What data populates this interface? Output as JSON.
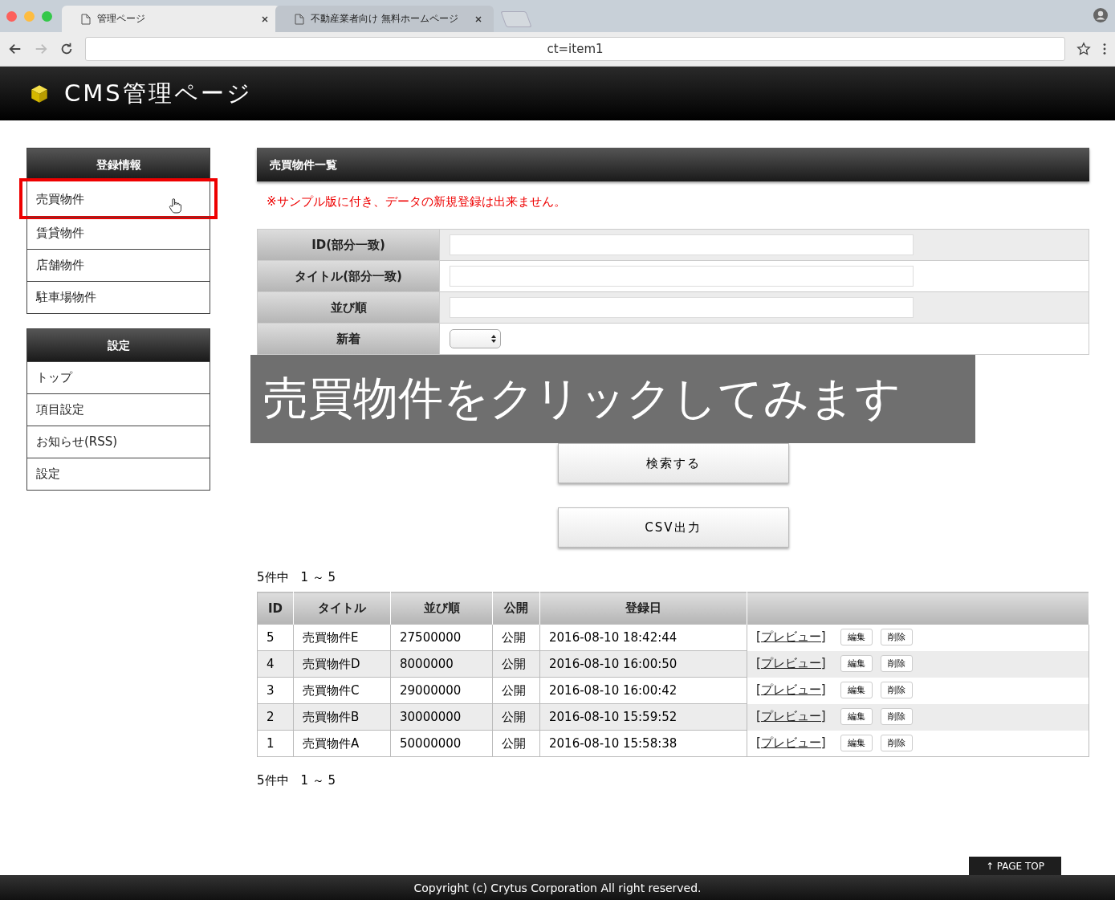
{
  "browser": {
    "tabs": [
      {
        "title": "管理ページ",
        "selected": true
      },
      {
        "title": "不動産業者向け 無料ホームページ",
        "selected": false
      }
    ],
    "address": "ct=item1"
  },
  "header": {
    "title": "CMS管理ページ"
  },
  "sidebar": [
    {
      "heading": "登録情報",
      "items": [
        {
          "label": "売買物件",
          "selected": true
        },
        {
          "label": "賃貸物件",
          "selected": false
        },
        {
          "label": "店舗物件",
          "selected": false
        },
        {
          "label": "駐車場物件",
          "selected": false
        }
      ]
    },
    {
      "heading": "設定",
      "items": [
        {
          "label": "トップ",
          "selected": false
        },
        {
          "label": "項目設定",
          "selected": false
        },
        {
          "label": "お知らせ(RSS)",
          "selected": false
        },
        {
          "label": "設定",
          "selected": false
        }
      ]
    }
  ],
  "main": {
    "title": "売買物件一覧",
    "notice": "※サンプル版に付き、データの新規登録は出来ません。",
    "form": [
      {
        "label": "ID(部分一致)",
        "kind": "text"
      },
      {
        "label": "タイトル(部分一致)",
        "kind": "text"
      },
      {
        "label": "並び順",
        "kind": "text"
      },
      {
        "label": "新着",
        "kind": "select"
      }
    ],
    "search_button": "検索する",
    "csv_button": "CSV出力",
    "count_top": "5件中　1 ～ 5",
    "table": {
      "columns": [
        "ID",
        "タイトル",
        "並び順",
        "公開",
        "登録日"
      ],
      "rows": [
        {
          "cells": [
            "5",
            "売買物件E",
            "27500000",
            "公開",
            "2016-08-10 18:42:44"
          ],
          "preview": "[プレビュー]",
          "edit": "編集",
          "delete": "削除"
        },
        {
          "cells": [
            "4",
            "売買物件D",
            "8000000",
            "公開",
            "2016-08-10 16:00:50"
          ],
          "preview": "[プレビュー]",
          "edit": "編集",
          "delete": "削除"
        },
        {
          "cells": [
            "3",
            "売買物件C",
            "29000000",
            "公開",
            "2016-08-10 16:00:42"
          ],
          "preview": "[プレビュー]",
          "edit": "編集",
          "delete": "削除"
        },
        {
          "cells": [
            "2",
            "売買物件B",
            "30000000",
            "公開",
            "2016-08-10 15:59:52"
          ],
          "preview": "[プレビュー]",
          "edit": "編集",
          "delete": "削除"
        },
        {
          "cells": [
            "1",
            "売買物件A",
            "50000000",
            "公開",
            "2016-08-10 15:58:38"
          ],
          "preview": "[プレビュー]",
          "edit": "編集",
          "delete": "削除"
        }
      ]
    },
    "count_bottom": "5件中　1 ～ 5"
  },
  "caption": "売買物件をクリックしてみます",
  "page_top": "↑ PAGE TOP",
  "footer": "Copyright (c) Crytus Corporation All right reserved."
}
